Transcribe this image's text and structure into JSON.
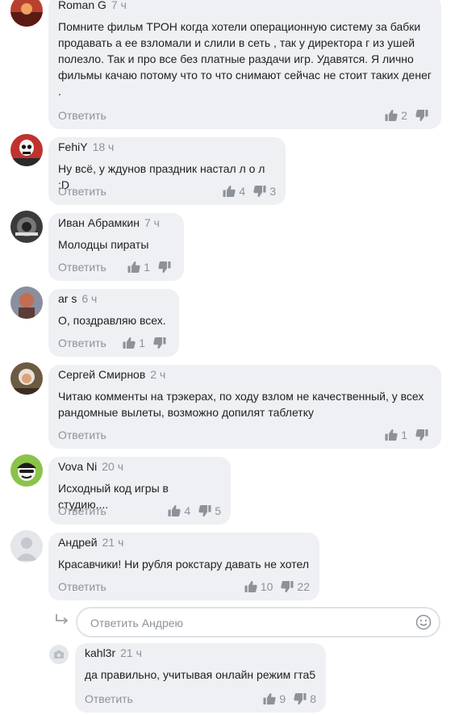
{
  "comments": [
    {
      "author": "Roman G",
      "time": "7 ч",
      "text": "Помните фильм ТРОН когда хотели операционную систему за бабки продавать а ее взломали и слили в сеть , так у директора г из ушей полезло. Так и про все без платные раздачи игр. Удавятся. Я лично фильмы качаю потому что то что снимают сейчас не стоит таких денег .",
      "reply_label": "Ответить",
      "likes": "2",
      "dislikes": ""
    },
    {
      "author": "FehiY",
      "time": "18 ч",
      "text": "Ну всё, у ждунов праздник настал л о л :D",
      "reply_label": "Ответить",
      "likes": "4",
      "dislikes": "3"
    },
    {
      "author": "Иван Абрамкин",
      "time": "7 ч",
      "text": "Молодцы пираты",
      "reply_label": "Ответить",
      "likes": "1",
      "dislikes": ""
    },
    {
      "author": "ar s",
      "time": "6 ч",
      "text": "О, поздравляю всех.",
      "reply_label": "Ответить",
      "likes": "1",
      "dislikes": ""
    },
    {
      "author": "Сергей Смирнов",
      "time": "2 ч",
      "text": "Читаю комменты на трэкерах, по ходу взлом не качественный, у всех рандомные вылеты, возможно допилят таблетку",
      "reply_label": "Ответить",
      "likes": "1",
      "dislikes": ""
    },
    {
      "author": "Vova Ni",
      "time": "20 ч",
      "text": "Исходный код игры в студию....",
      "reply_label": "Ответить",
      "likes": "4",
      "dislikes": "5"
    },
    {
      "author": "Андрей",
      "time": "21 ч",
      "text": "Красавчики! Ни рубля рокстару давать не хотел",
      "reply_label": "Ответить",
      "likes": "10",
      "dislikes": "22"
    },
    {
      "author": "kahl3r",
      "time": "21 ч",
      "text": "да правильно, учитывая онлайн режим гта5",
      "reply_label": "Ответить",
      "likes": "9",
      "dislikes": "8"
    }
  ],
  "reply_input": {
    "placeholder": "Ответить Андрею"
  },
  "icons": {
    "like": "thumbs-up-icon",
    "dislike": "thumbs-down-icon",
    "emoji": "smile-icon",
    "reply_arrow": "reply-arrow-icon",
    "camera": "camera-icon"
  },
  "colors": {
    "bubble": "#eef0f3",
    "muted": "#8d9299",
    "text": "#1f1f1f"
  }
}
